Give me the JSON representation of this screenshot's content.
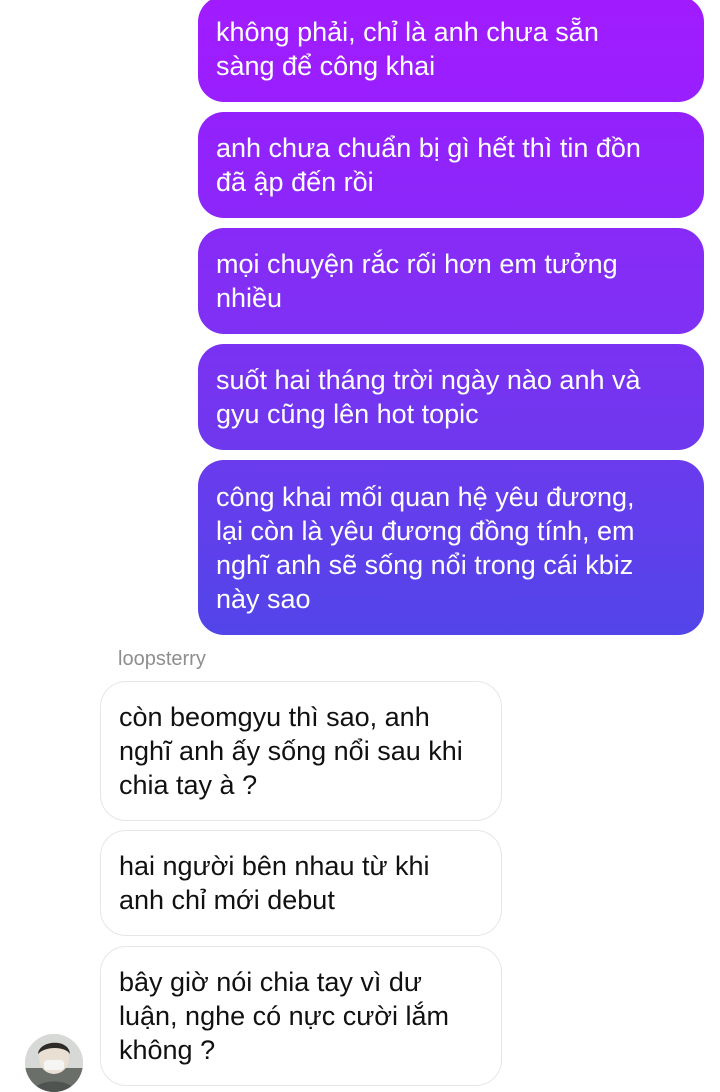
{
  "thread": {
    "outgoing": [
      {
        "text": "không phải, chỉ là anh chưa sẵn\nsàng để công khai",
        "color": "#9b1fff"
      },
      {
        "text": "anh chưa chuẩn bị gì hết thì tin đồn\nđã ập đến rồi",
        "color": "#8f24fb"
      },
      {
        "text": "mọi chuyện rắc rối hơn em tưởng\nnhiều",
        "color": "#832cf6"
      },
      {
        "text": "suốt hai tháng trời ngày nào anh và\ngyu cũng lên hot topic",
        "color": "#7535f0"
      },
      {
        "text": "công khai mối quan hệ yêu đương,\nlại còn là yêu đương đồng tính, em\nnghĩ anh sẽ sống nổi trong cái kbiz\nnày sao",
        "color": "#5e42ea"
      }
    ],
    "sender_name": "loopsterry",
    "incoming": [
      {
        "text": "còn beomgyu thì sao, anh\nnghĩ anh ấy sống nổi sau khi\nchia tay à ?"
      },
      {
        "text": "hai người bên nhau từ khi\nanh chỉ mới debut"
      },
      {
        "text": "bây giờ nói chia tay vì dư\nluận, nghe có nực cười lắm\nkhông ?"
      }
    ]
  },
  "avatar_icon": "profile-photo-avatar"
}
